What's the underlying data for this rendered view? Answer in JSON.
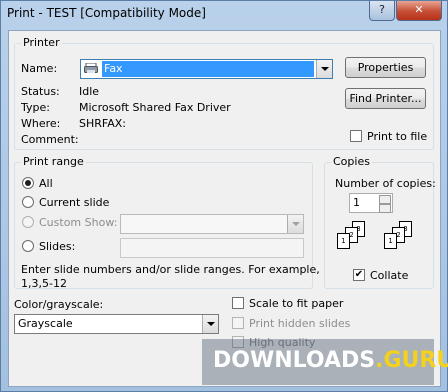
{
  "window": {
    "title": "Print - TEST [Compatibility Mode]",
    "help": "?",
    "close": "✕"
  },
  "printer": {
    "group": "Printer",
    "name_label": "Name:",
    "name_value": "Fax",
    "status_label": "Status:",
    "status_value": "Idle",
    "type_label": "Type:",
    "type_value": "Microsoft Shared Fax Driver",
    "where_label": "Where:",
    "where_value": "SHRFAX:",
    "comment_label": "Comment:",
    "properties": "Properties",
    "find_printer": "Find Printer...",
    "print_to_file": "Print to file"
  },
  "print_range": {
    "group": "Print range",
    "all": "All",
    "current_slide": "Current slide",
    "custom_show": "Custom Show:",
    "slides": "Slides:",
    "hint": "Enter slide numbers and/or slide ranges. For example,",
    "hint_example": "1,3,5-12"
  },
  "copies": {
    "group": "Copies",
    "number_label": "Number of copies:",
    "number_value": "1",
    "collate": "Collate"
  },
  "color": {
    "label": "Color/grayscale:",
    "value": "Grayscale"
  },
  "options": {
    "scale_to_fit": "Scale to fit paper",
    "print_hidden": "Print hidden slides",
    "high_quality": "High quality"
  },
  "watermark": {
    "text_a": "DOWNLOADS",
    "text_b": ".GURU"
  }
}
